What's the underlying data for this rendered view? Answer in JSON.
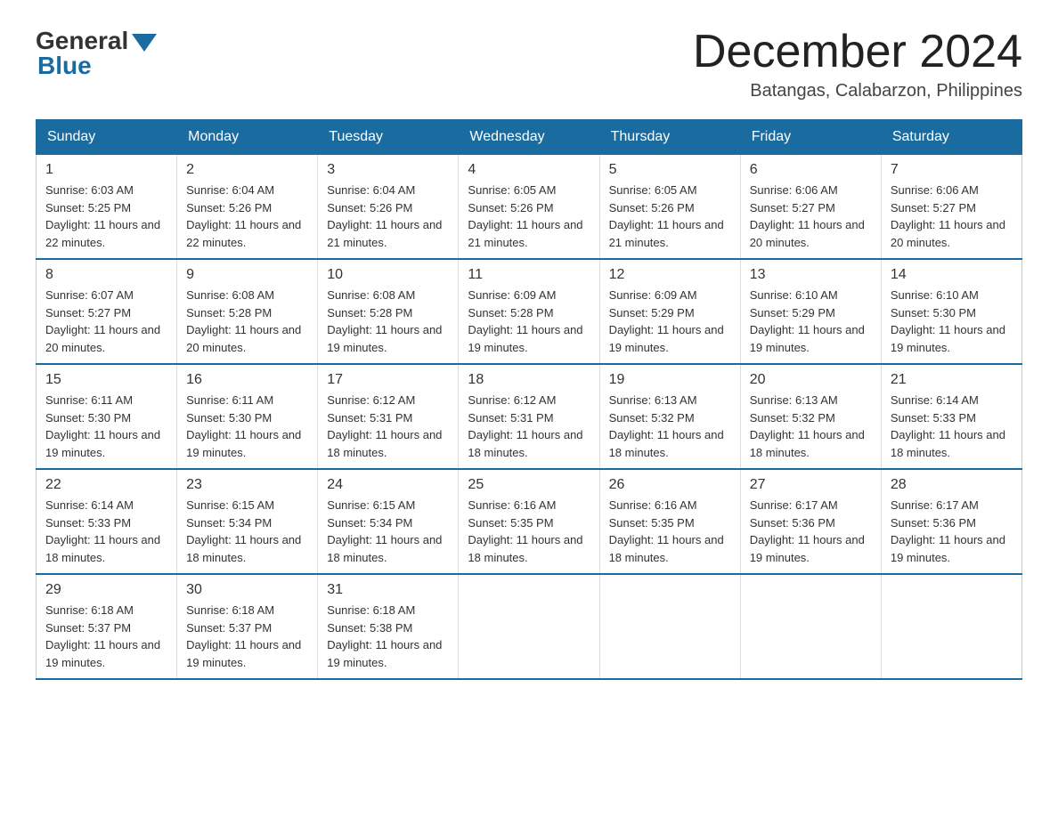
{
  "header": {
    "logo_general": "General",
    "logo_blue": "Blue",
    "month_title": "December 2024",
    "location": "Batangas, Calabarzon, Philippines"
  },
  "days_of_week": [
    "Sunday",
    "Monday",
    "Tuesday",
    "Wednesday",
    "Thursday",
    "Friday",
    "Saturday"
  ],
  "weeks": [
    [
      {
        "day": "1",
        "sunrise": "6:03 AM",
        "sunset": "5:25 PM",
        "daylight": "11 hours and 22 minutes."
      },
      {
        "day": "2",
        "sunrise": "6:04 AM",
        "sunset": "5:26 PM",
        "daylight": "11 hours and 22 minutes."
      },
      {
        "day": "3",
        "sunrise": "6:04 AM",
        "sunset": "5:26 PM",
        "daylight": "11 hours and 21 minutes."
      },
      {
        "day": "4",
        "sunrise": "6:05 AM",
        "sunset": "5:26 PM",
        "daylight": "11 hours and 21 minutes."
      },
      {
        "day": "5",
        "sunrise": "6:05 AM",
        "sunset": "5:26 PM",
        "daylight": "11 hours and 21 minutes."
      },
      {
        "day": "6",
        "sunrise": "6:06 AM",
        "sunset": "5:27 PM",
        "daylight": "11 hours and 20 minutes."
      },
      {
        "day": "7",
        "sunrise": "6:06 AM",
        "sunset": "5:27 PM",
        "daylight": "11 hours and 20 minutes."
      }
    ],
    [
      {
        "day": "8",
        "sunrise": "6:07 AM",
        "sunset": "5:27 PM",
        "daylight": "11 hours and 20 minutes."
      },
      {
        "day": "9",
        "sunrise": "6:08 AM",
        "sunset": "5:28 PM",
        "daylight": "11 hours and 20 minutes."
      },
      {
        "day": "10",
        "sunrise": "6:08 AM",
        "sunset": "5:28 PM",
        "daylight": "11 hours and 19 minutes."
      },
      {
        "day": "11",
        "sunrise": "6:09 AM",
        "sunset": "5:28 PM",
        "daylight": "11 hours and 19 minutes."
      },
      {
        "day": "12",
        "sunrise": "6:09 AM",
        "sunset": "5:29 PM",
        "daylight": "11 hours and 19 minutes."
      },
      {
        "day": "13",
        "sunrise": "6:10 AM",
        "sunset": "5:29 PM",
        "daylight": "11 hours and 19 minutes."
      },
      {
        "day": "14",
        "sunrise": "6:10 AM",
        "sunset": "5:30 PM",
        "daylight": "11 hours and 19 minutes."
      }
    ],
    [
      {
        "day": "15",
        "sunrise": "6:11 AM",
        "sunset": "5:30 PM",
        "daylight": "11 hours and 19 minutes."
      },
      {
        "day": "16",
        "sunrise": "6:11 AM",
        "sunset": "5:30 PM",
        "daylight": "11 hours and 19 minutes."
      },
      {
        "day": "17",
        "sunrise": "6:12 AM",
        "sunset": "5:31 PM",
        "daylight": "11 hours and 18 minutes."
      },
      {
        "day": "18",
        "sunrise": "6:12 AM",
        "sunset": "5:31 PM",
        "daylight": "11 hours and 18 minutes."
      },
      {
        "day": "19",
        "sunrise": "6:13 AM",
        "sunset": "5:32 PM",
        "daylight": "11 hours and 18 minutes."
      },
      {
        "day": "20",
        "sunrise": "6:13 AM",
        "sunset": "5:32 PM",
        "daylight": "11 hours and 18 minutes."
      },
      {
        "day": "21",
        "sunrise": "6:14 AM",
        "sunset": "5:33 PM",
        "daylight": "11 hours and 18 minutes."
      }
    ],
    [
      {
        "day": "22",
        "sunrise": "6:14 AM",
        "sunset": "5:33 PM",
        "daylight": "11 hours and 18 minutes."
      },
      {
        "day": "23",
        "sunrise": "6:15 AM",
        "sunset": "5:34 PM",
        "daylight": "11 hours and 18 minutes."
      },
      {
        "day": "24",
        "sunrise": "6:15 AM",
        "sunset": "5:34 PM",
        "daylight": "11 hours and 18 minutes."
      },
      {
        "day": "25",
        "sunrise": "6:16 AM",
        "sunset": "5:35 PM",
        "daylight": "11 hours and 18 minutes."
      },
      {
        "day": "26",
        "sunrise": "6:16 AM",
        "sunset": "5:35 PM",
        "daylight": "11 hours and 18 minutes."
      },
      {
        "day": "27",
        "sunrise": "6:17 AM",
        "sunset": "5:36 PM",
        "daylight": "11 hours and 19 minutes."
      },
      {
        "day": "28",
        "sunrise": "6:17 AM",
        "sunset": "5:36 PM",
        "daylight": "11 hours and 19 minutes."
      }
    ],
    [
      {
        "day": "29",
        "sunrise": "6:18 AM",
        "sunset": "5:37 PM",
        "daylight": "11 hours and 19 minutes."
      },
      {
        "day": "30",
        "sunrise": "6:18 AM",
        "sunset": "5:37 PM",
        "daylight": "11 hours and 19 minutes."
      },
      {
        "day": "31",
        "sunrise": "6:18 AM",
        "sunset": "5:38 PM",
        "daylight": "11 hours and 19 minutes."
      },
      null,
      null,
      null,
      null
    ]
  ]
}
